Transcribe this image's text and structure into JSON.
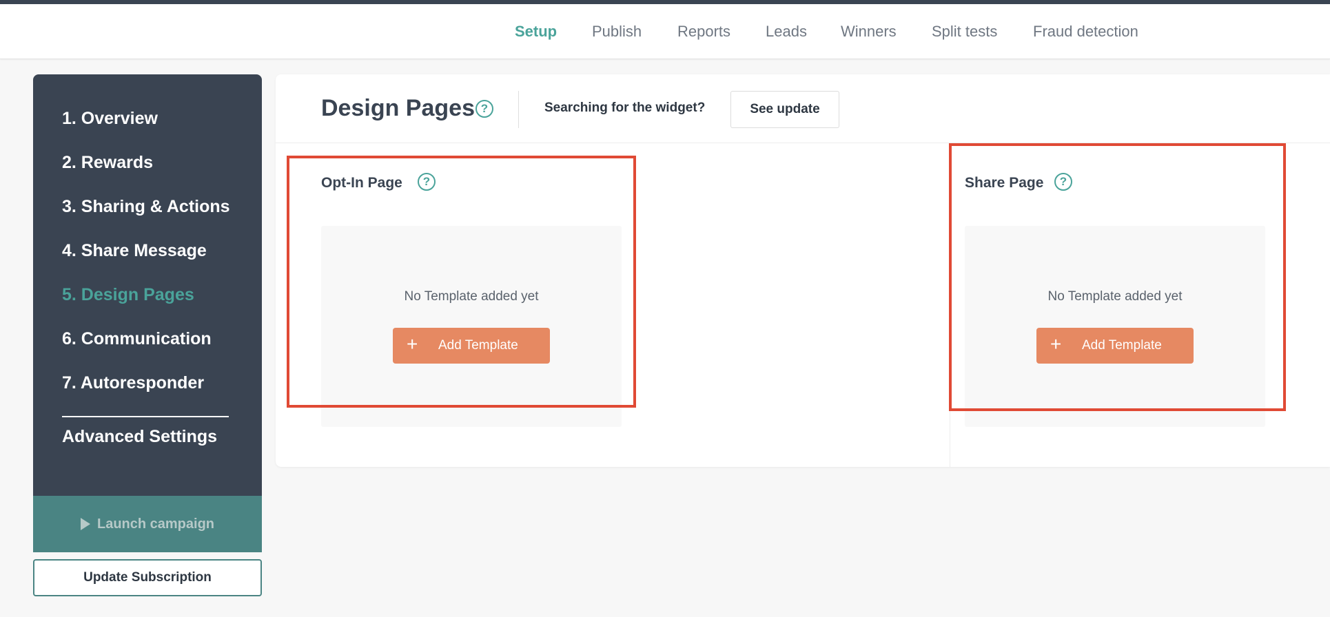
{
  "top_nav": {
    "tabs": [
      {
        "label": "Setup",
        "active": true
      },
      {
        "label": "Publish"
      },
      {
        "label": "Reports"
      },
      {
        "label": "Leads"
      },
      {
        "label": "Winners"
      },
      {
        "label": "Split tests"
      },
      {
        "label": "Fraud detection"
      }
    ]
  },
  "sidebar": {
    "items": [
      {
        "label": "1. Overview"
      },
      {
        "label": "2. Rewards"
      },
      {
        "label": "3. Sharing & Actions"
      },
      {
        "label": "4. Share Message"
      },
      {
        "label": "5. Design Pages",
        "active": true
      },
      {
        "label": "6. Communication"
      },
      {
        "label": "7. Autoresponder"
      }
    ],
    "advanced": "Advanced Settings",
    "launch_label": "Launch campaign",
    "update_subscription_label": "Update Subscription"
  },
  "main": {
    "title": "Design Pages",
    "help_glyph": "?",
    "search_question": "Searching for the widget?",
    "see_update_label": "See update",
    "sections": [
      {
        "title": "Opt-In Page",
        "empty_text": "No Template added yet",
        "add_label": "Add Template",
        "plus": "+"
      },
      {
        "title": "Share Page",
        "empty_text": "No Template added yet",
        "add_label": "Add Template",
        "plus": "+"
      }
    ]
  },
  "colors": {
    "accent": "#4aa39a",
    "sidebar_bg": "#3a4452",
    "add_button": "#e68962",
    "highlight": "#e04a35",
    "launch_bg": "#4a8483"
  }
}
